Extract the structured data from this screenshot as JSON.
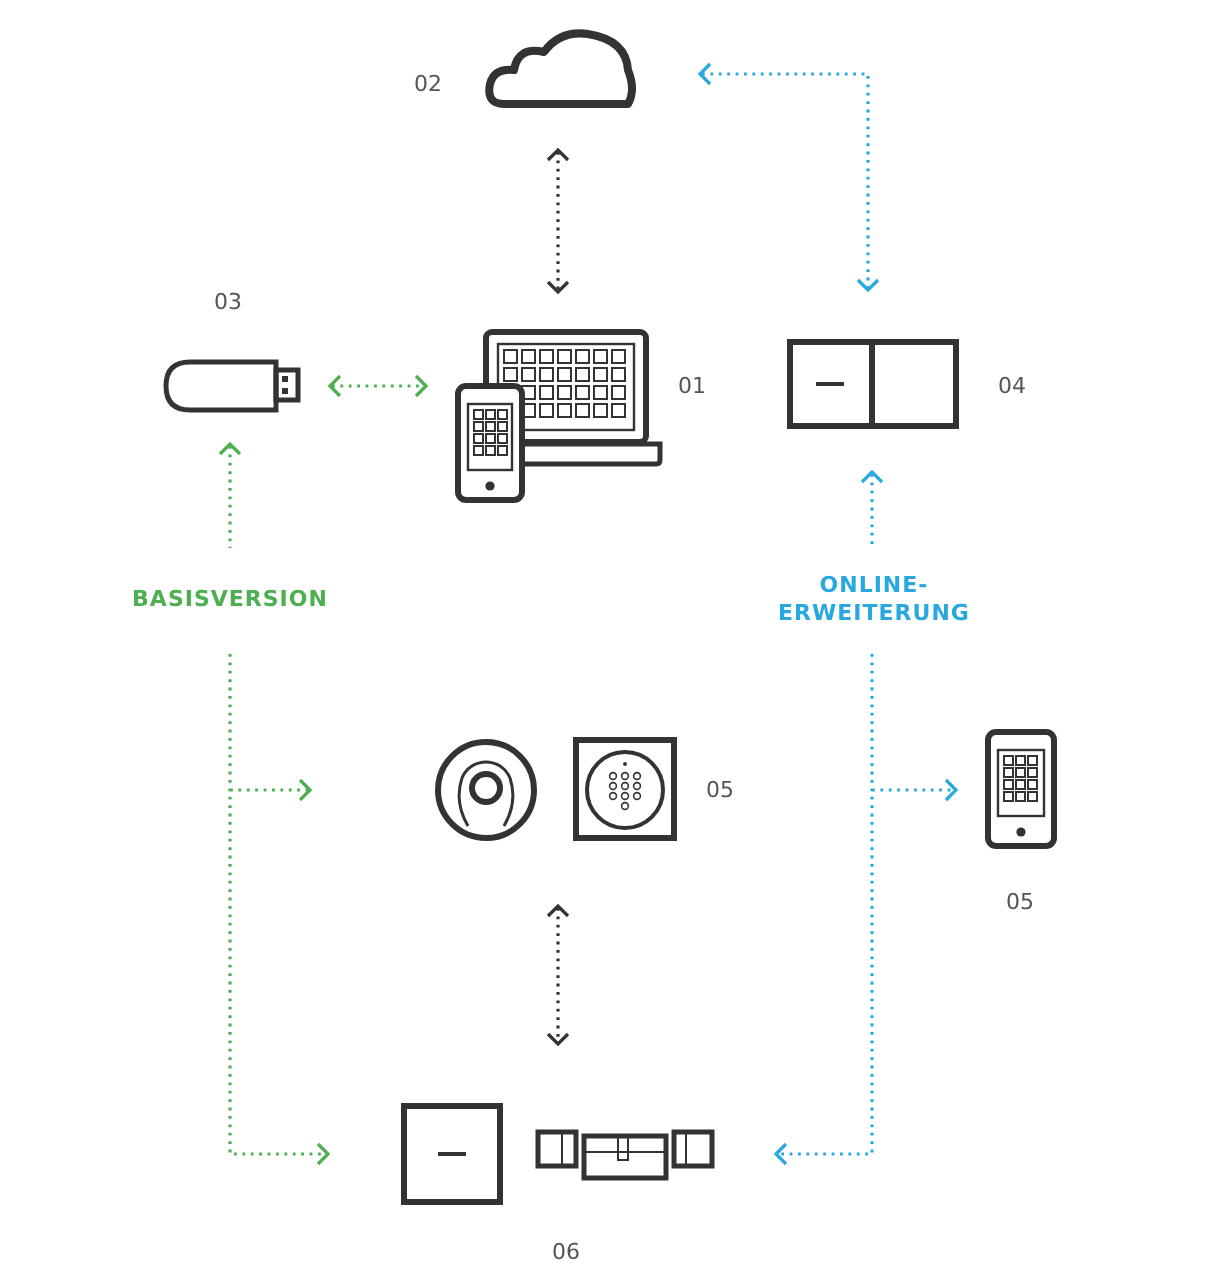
{
  "node_labels": [
    "02",
    "03",
    "01",
    "04",
    "05",
    "05",
    "06"
  ],
  "groups": [
    {
      "label": "BASISVERSION",
      "color": "#4caf50"
    },
    {
      "label": "ONLINE-ERWEITERUNG",
      "color": "#29a8e0"
    }
  ]
}
